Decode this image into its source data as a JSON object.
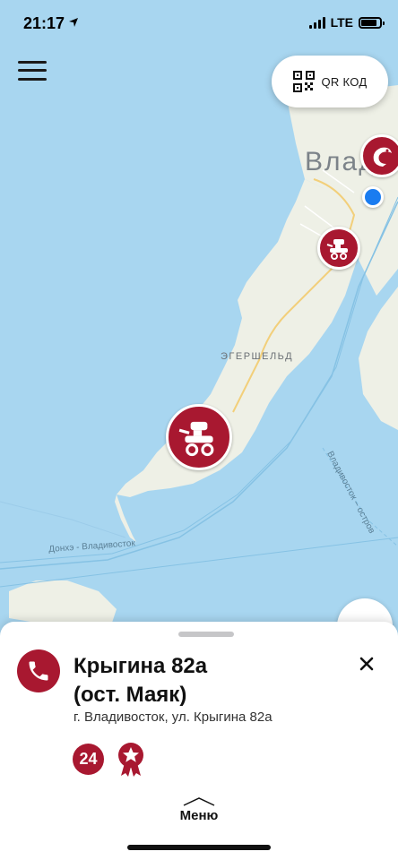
{
  "status_bar": {
    "time": "21:17",
    "network": "LTE"
  },
  "header": {
    "qr_label": "QR КОД"
  },
  "map": {
    "city_label": "Влад",
    "district_label": "ЭГЕРШЕЛЬД",
    "route_label_1": "Донхэ - Владивосток",
    "route_label_2": "Владивосток – остров"
  },
  "location": {
    "title": "Крыгина 82а\n(ост. Маяк)",
    "title_line1": "Крыгина 82а",
    "title_line2": "(ост. Маяк)",
    "address": "г. Владивосток, ул. Крыгина 82а",
    "badge_hours": "24"
  },
  "bottom_nav": {
    "menu_label": "Меню"
  },
  "colors": {
    "brand": "#a81830",
    "water": "#a8d6f0",
    "land": "#eef0e6",
    "location_dot": "#1a7cf0"
  },
  "icons": [
    "menu-icon",
    "qr-code-icon",
    "phone-icon",
    "close-icon",
    "award-icon",
    "chevron-up-icon",
    "cart-robot-icon",
    "shrimp-icon"
  ]
}
